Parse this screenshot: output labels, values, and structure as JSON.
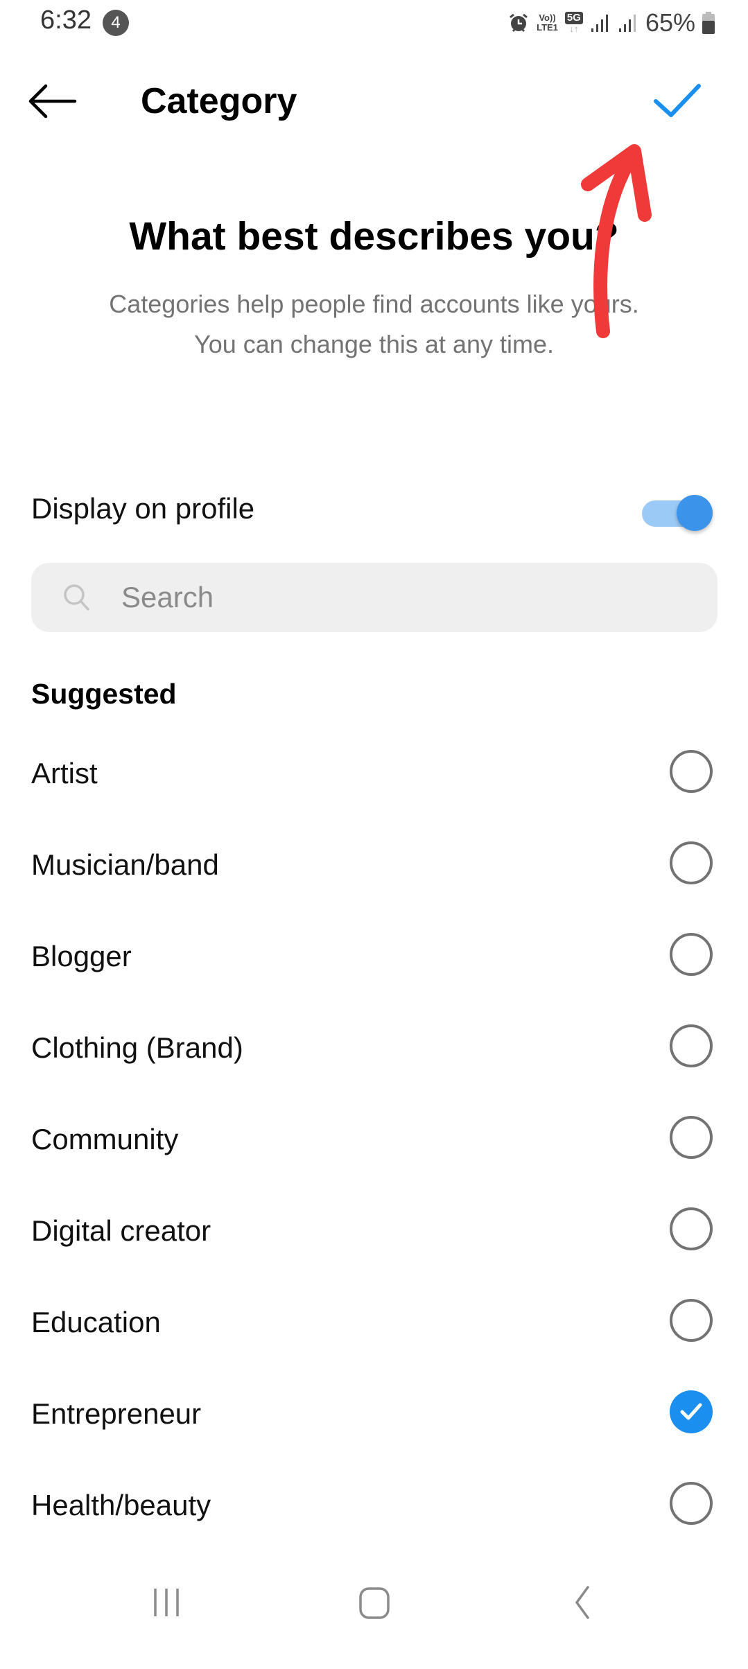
{
  "status_bar": {
    "time": "6:32",
    "notification_count": "4",
    "volte_label": "Vo))",
    "lte_label": "LTE1",
    "network_label": "5G",
    "network_arrows": "↓↑",
    "battery_percent": "65%",
    "icons": [
      "alarm-icon",
      "volte-icon",
      "5g-icon",
      "signal-icon",
      "signal-icon",
      "battery-icon"
    ]
  },
  "header": {
    "back_icon": "arrow-left-icon",
    "title": "Category",
    "confirm_icon": "checkmark-icon",
    "confirm_color": "#1a8ff0"
  },
  "intro": {
    "heading": "What best describes you?",
    "subtitle_line1": "Categories help people find accounts like yours.",
    "subtitle_line2": "You can change this at any time."
  },
  "display_on_profile": {
    "label": "Display on profile",
    "enabled": true,
    "accent_color": "#3b93ea"
  },
  "search": {
    "placeholder": "Search",
    "value": ""
  },
  "suggested": {
    "title": "Suggested",
    "items": [
      {
        "label": "Artist",
        "selected": false
      },
      {
        "label": "Musician/band",
        "selected": false
      },
      {
        "label": "Blogger",
        "selected": false
      },
      {
        "label": "Clothing (Brand)",
        "selected": false
      },
      {
        "label": "Community",
        "selected": false
      },
      {
        "label": "Digital creator",
        "selected": false
      },
      {
        "label": "Education",
        "selected": false
      },
      {
        "label": "Entrepreneur",
        "selected": true
      },
      {
        "label": "Health/beauty",
        "selected": false
      }
    ]
  },
  "annotation": {
    "type": "hand-drawn-arrow",
    "points_to": "confirm-button",
    "color": "#f03a3a"
  },
  "nav_bar": {
    "buttons": [
      "recents-icon",
      "home-icon",
      "back-icon"
    ]
  }
}
